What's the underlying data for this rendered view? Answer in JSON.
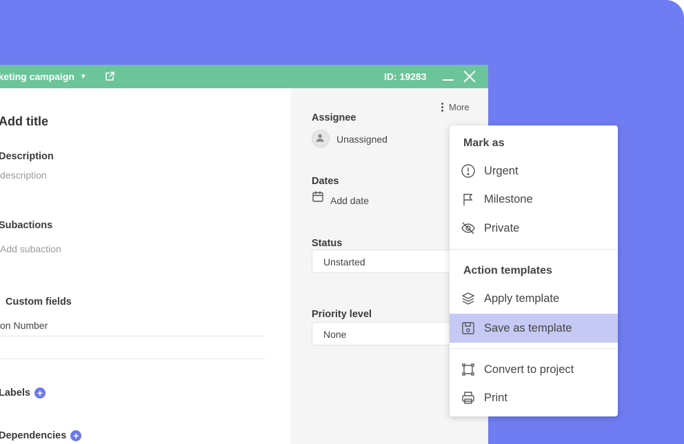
{
  "window": {
    "project_name": "rketing campaign",
    "id_label": "ID: 19283"
  },
  "left": {
    "title_placeholder": "Add title",
    "description_label": "Description",
    "description_placeholder": "description",
    "subactions_label": "Subactions",
    "subactions_placeholder": "Add subaction",
    "custom_fields_label": "Custom fields",
    "custom_field_row": "on Number",
    "labels_label": "Labels",
    "dependencies_label": "Dependencies"
  },
  "right": {
    "more_label": "More",
    "assignee_label": "Assignee",
    "assignee_value": "Unassigned",
    "dates_label": "Dates",
    "dates_value": "Add date",
    "status_label": "Status",
    "status_value": "Unstarted",
    "priority_label": "Priority level",
    "priority_value": "None"
  },
  "menu": {
    "mark_as_header": "Mark as",
    "urgent": "Urgent",
    "milestone": "Milestone",
    "private": "Private",
    "templates_header": "Action templates",
    "apply_template": "Apply template",
    "save_as_template": "Save as template",
    "convert_to_project": "Convert to project",
    "print": "Print"
  },
  "colors": {
    "background": "#707cf1",
    "titlebar": "#6cc49a",
    "highlight": "#c5c9f3",
    "accent": "#6c7ae8"
  },
  "icons": [
    "external-link-icon",
    "minimize-icon",
    "close-icon",
    "kebab-icon",
    "user-icon",
    "calendar-icon",
    "chevron-down-icon",
    "alert-icon",
    "flag-icon",
    "eye-off-icon",
    "layers-icon",
    "save-icon",
    "frame-icon",
    "printer-icon",
    "plus-icon"
  ]
}
